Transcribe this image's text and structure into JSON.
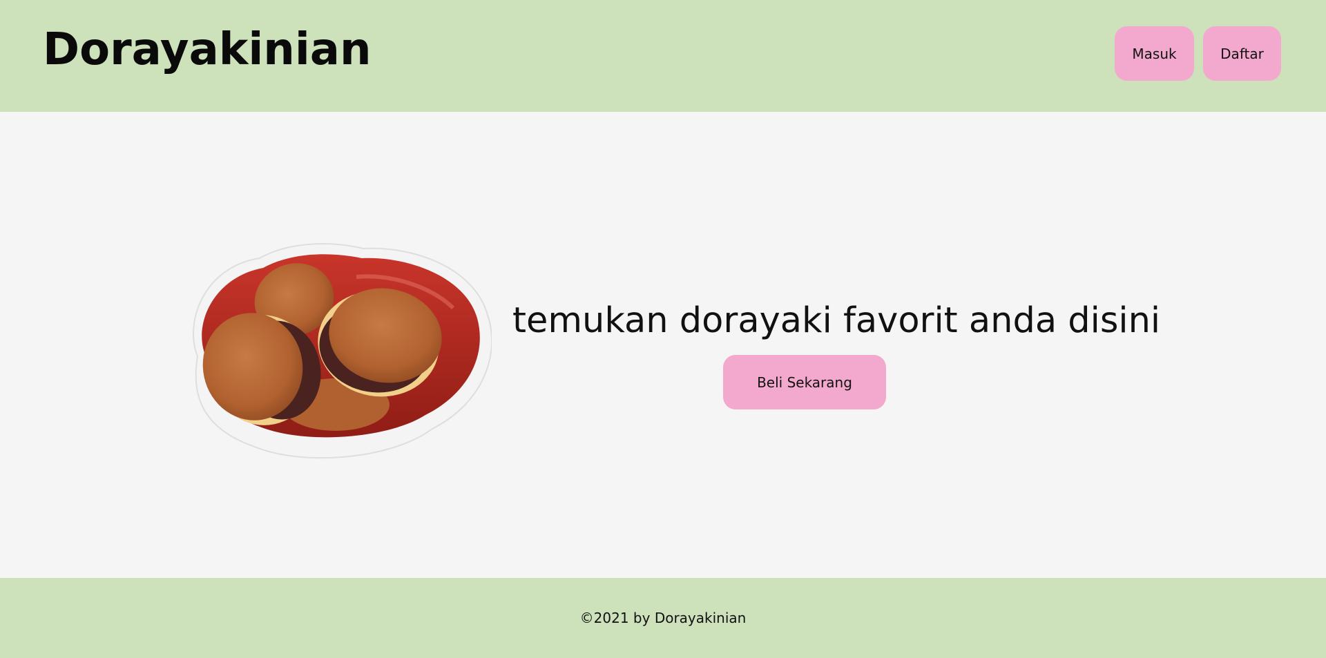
{
  "header": {
    "brand": "Dorayakinian",
    "login_label": "Masuk",
    "register_label": "Daftar"
  },
  "main": {
    "tagline": "temukan dorayaki favorit anda disini",
    "buy_label": "Beli Sekarang",
    "hero_image_icon": "dorayaki-bowl-image"
  },
  "footer": {
    "copyright": "©2021 by Dorayakinian"
  },
  "colors": {
    "header_bg": "#cde1bb",
    "footer_bg": "#cde1bb",
    "button_bg": "#f3a9cd",
    "page_bg": "#f5f5f5"
  }
}
